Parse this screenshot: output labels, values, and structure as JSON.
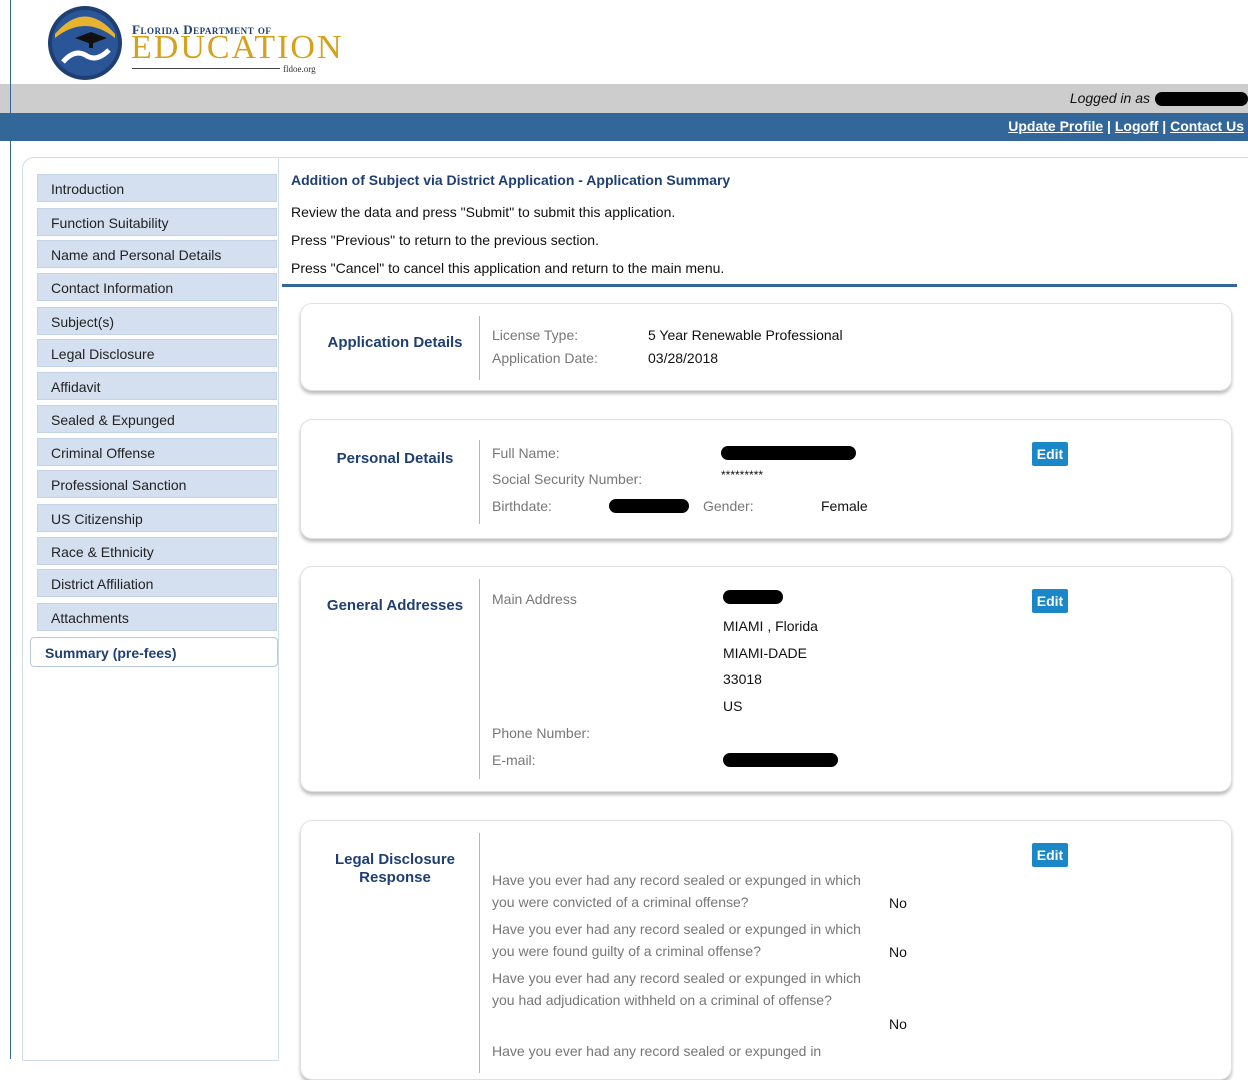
{
  "logo": {
    "line1": "Florida Department of",
    "line2": "EDUCATION",
    "line3": "fldoe.org"
  },
  "login": {
    "text": "Logged in as"
  },
  "nav": {
    "update_profile": "Update Profile",
    "logoff": "Logoff",
    "contact_us": "Contact Us",
    "sep": "|"
  },
  "sidebar": {
    "items": [
      "Introduction",
      "Function Suitability",
      "Name and Personal Details",
      "Contact Information",
      "Subject(s)",
      "Legal Disclosure",
      "Affidavit",
      "Sealed & Expunged",
      "Criminal Offense",
      "Professional Sanction",
      "US Citizenship",
      "Race & Ethnicity",
      "District Affiliation",
      "Attachments"
    ],
    "active": "Summary (pre-fees)"
  },
  "main": {
    "title": "Addition of Subject via District Application - Application Summary",
    "instructions": [
      "Review the data and press \"Submit\" to submit this application.",
      "Press \"Previous\" to return to the previous section.",
      "Press \"Cancel\" to cancel this application and return to the main menu."
    ]
  },
  "app_details": {
    "label": "Application Details",
    "license_type_label": "License Type:",
    "license_type": "5 Year Renewable Professional",
    "app_date_label": "Application Date:",
    "app_date": "03/28/2018"
  },
  "personal": {
    "label": "Personal Details",
    "full_name_label": "Full Name:",
    "ssn_label": "Social Security Number:",
    "ssn": "*********",
    "birthdate_label": "Birthdate:",
    "gender_label": "Gender:",
    "gender": "Female",
    "edit": "Edit"
  },
  "addresses": {
    "label": "General Addresses",
    "main_address_label": "Main Address",
    "city_state": "MIAMI , Florida",
    "county": "MIAMI-DADE",
    "zip": "33018",
    "country": "US",
    "phone_label": "Phone Number:",
    "email_label": "E-mail:",
    "edit": "Edit"
  },
  "legal": {
    "label": "Legal Disclosure Response",
    "edit": "Edit",
    "questions": [
      {
        "q": "Have you ever had any record sealed or expunged in which you were convicted of a criminal offense?",
        "a": "No"
      },
      {
        "q": "Have you ever had any record sealed or expunged in which you were found guilty of a criminal offense?",
        "a": "No"
      },
      {
        "q": "Have you ever had any record sealed or expunged in which you had adjudication withheld on a criminal of offense?",
        "a": "No"
      },
      {
        "q": "Have you ever had any record sealed or expunged in",
        "a": ""
      }
    ]
  }
}
